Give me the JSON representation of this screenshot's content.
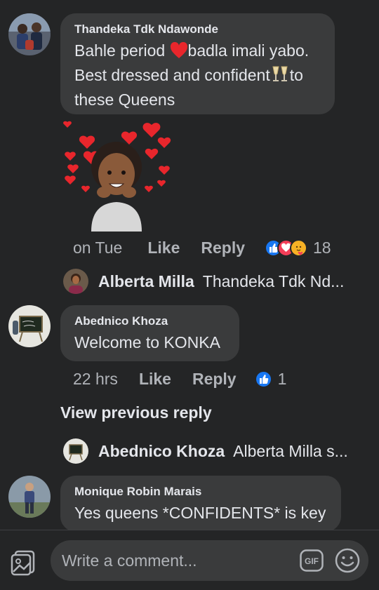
{
  "comments": [
    {
      "author": "Thandeka Tdk Ndawonde",
      "line1_a": "Bahle period ",
      "line1_b": "badla imali yabo.",
      "line2_a": "Best dressed and confident",
      "line2_b": "to",
      "line3": "these Queens",
      "time": "on Tue",
      "like": "Like",
      "reply": "Reply",
      "reaction_count": "18"
    },
    {
      "author": "Abednico Khoza",
      "text": "Welcome to KONKA",
      "time": "22 hrs",
      "like": "Like",
      "reply": "Reply",
      "reaction_count": "1"
    },
    {
      "author": "Monique Robin Marais",
      "text": "Yes queens *CONFIDENTS* is key"
    }
  ],
  "replies": [
    {
      "name": "Alberta Milla",
      "text": "Thandeka Tdk Nd..."
    },
    {
      "name": "Abednico Khoza",
      "text": "Alberta Milla s..."
    }
  ],
  "view_previous": "View previous reply",
  "composer": {
    "placeholder": "Write a comment...",
    "gif_label": "GIF"
  },
  "colors": {
    "background": "#242526",
    "bubble": "#3a3b3c",
    "text": "#e4e6eb",
    "muted": "#b0b3b8",
    "like_blue": "#1877f2",
    "love_red": "#f33e58",
    "care_yellow": "#f7b125"
  },
  "icons": [
    "heart-emoji",
    "champagne-emoji",
    "avatar-sticker",
    "like-reaction-icon",
    "love-reaction-icon",
    "care-reaction-icon",
    "photo-icon",
    "gif-icon",
    "smiley-icon"
  ]
}
